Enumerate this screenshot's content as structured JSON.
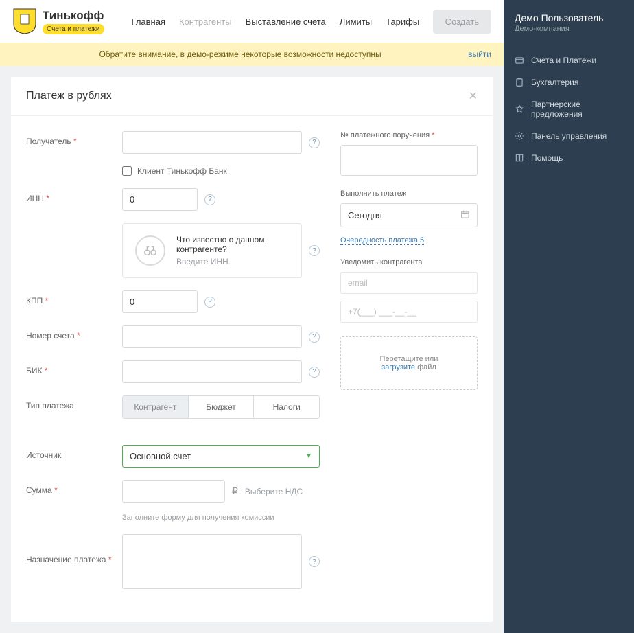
{
  "brand": {
    "name": "Тинькофф",
    "badge": "Счета и платежи"
  },
  "nav": {
    "home": "Главная",
    "counterparties": "Контрагенты",
    "invoicing": "Выставление счета",
    "limits": "Лимиты",
    "tariffs": "Тарифы",
    "create": "Создать"
  },
  "banner": {
    "text": "Обратите внимание, в демо-режиме некоторые возможности недоступны",
    "exit": "выйти"
  },
  "panel_title": "Платеж в рублях",
  "labels": {
    "recipient": "Получатель",
    "client_tinkoff": "Клиент Тинькофф Банк",
    "inn": "ИНН",
    "kpp": "КПП",
    "account_no": "Номер счета",
    "bik": "БИК",
    "pay_type": "Тип платежа",
    "source": "Источник",
    "amount": "Сумма",
    "purpose": "Назначение платежа"
  },
  "values": {
    "inn": "0",
    "kpp": "0"
  },
  "info": {
    "question": "Что известно о данном контрагенте?",
    "hint": "Введите ИНН."
  },
  "segments": {
    "counterparty": "Контрагент",
    "budget": "Бюджет",
    "taxes": "Налоги"
  },
  "source_select": "Основной счет",
  "vat_link": "Выберите НДС",
  "fee_hint": "Заполните форму для получения комиссии",
  "right": {
    "order_no": "№ платежного поручения",
    "execute": "Выполнить платеж",
    "today": "Сегодня",
    "priority": "Очередность платежа  5",
    "notify": "Уведомить контрагента",
    "email_ph": "email",
    "phone_ph": "+7(___) ___-__-__",
    "drop1": "Перетащите или",
    "drop2": "загрузите",
    "drop3": " файл"
  },
  "sidebar": {
    "user": "Демо Пользователь",
    "company": "Демо-компания",
    "items": {
      "accounts": "Счета и Платежи",
      "accounting": "Бухгалтерия",
      "partners": "Партнерские предложения",
      "admin": "Панель управления",
      "help": "Помощь"
    }
  }
}
